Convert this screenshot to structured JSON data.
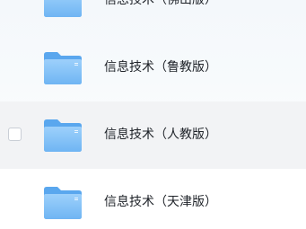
{
  "file_list": {
    "items": [
      {
        "name": "信息技术（佛山版）",
        "icon": "folder-icon",
        "selected": false
      },
      {
        "name": "信息技术（鲁教版）",
        "icon": "folder-icon",
        "selected": false
      },
      {
        "name": "信息技术（人教版）",
        "icon": "folder-icon",
        "selected": true
      },
      {
        "name": "信息技术（天津版）",
        "icon": "folder-icon",
        "selected": false
      }
    ]
  },
  "colors": {
    "folder_back": "#5aa7ee",
    "folder_front_top": "#9dd0fb",
    "folder_front_bottom": "#6fb5f3",
    "hover_row": "#f2f3f5",
    "text": "#1f2329"
  }
}
